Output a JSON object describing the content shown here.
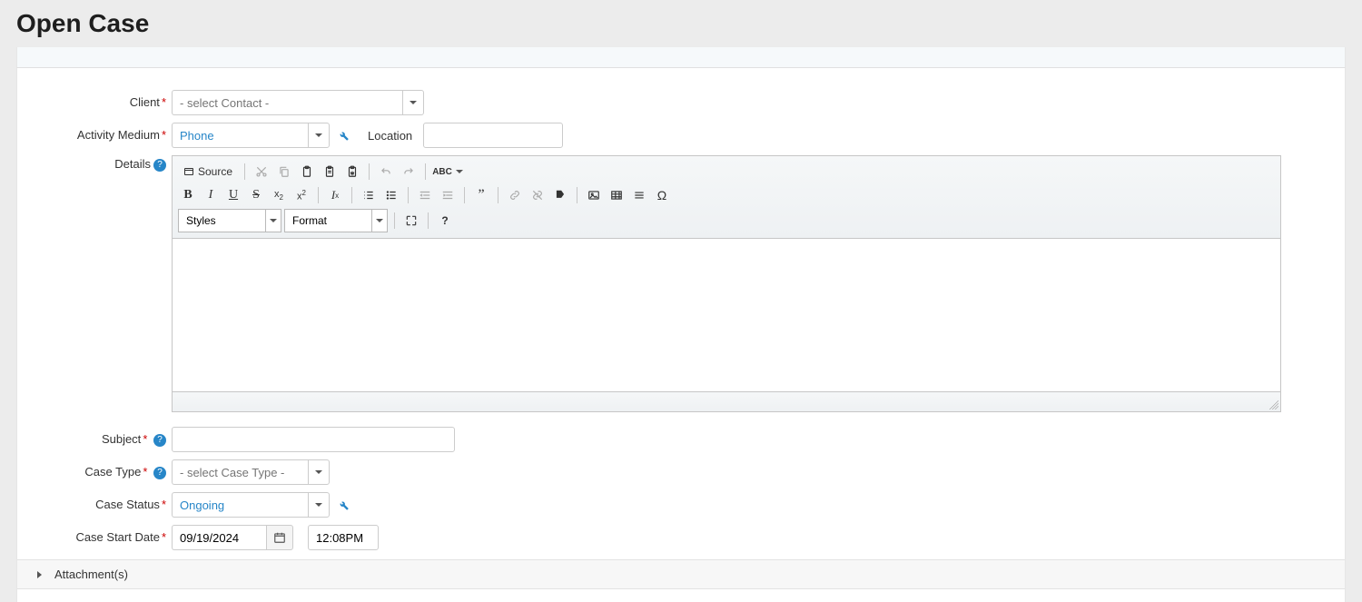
{
  "page": {
    "title": "Open Case"
  },
  "fields": {
    "client": {
      "label": "Client",
      "placeholder": "- select Contact -"
    },
    "activity_medium": {
      "label": "Activity Medium",
      "value": "Phone"
    },
    "location": {
      "label": "Location",
      "value": ""
    },
    "details": {
      "label": "Details"
    },
    "subject": {
      "label": "Subject",
      "value": ""
    },
    "case_type": {
      "label": "Case Type",
      "placeholder": "- select Case Type -"
    },
    "case_status": {
      "label": "Case Status",
      "value": "Ongoing"
    },
    "case_start_date": {
      "label": "Case Start Date",
      "date": "09/19/2024",
      "time": "12:08PM"
    }
  },
  "editor": {
    "source_label": "Source",
    "styles_label": "Styles",
    "format_label": "Format"
  },
  "attachments": {
    "label": "Attachment(s)"
  }
}
